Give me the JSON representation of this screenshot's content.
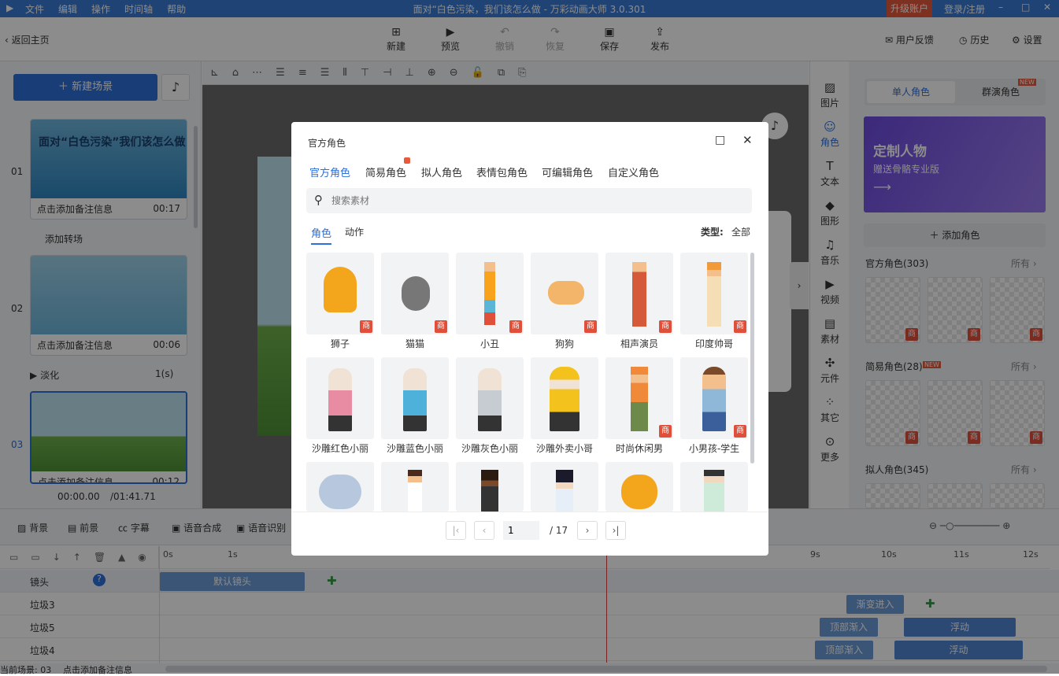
{
  "window": {
    "title": "面对“白色污染，我们该怎么做 - 万彩动画大师 3.0.301",
    "menu": [
      "文件",
      "编辑",
      "操作",
      "时间轴",
      "帮助"
    ],
    "upgrade": "升级账户",
    "login": "登录/注册"
  },
  "toolbar": {
    "back": "返回主页",
    "new": "新建",
    "preview": "预览",
    "undo": "撤销",
    "redo": "恢复",
    "save": "保存",
    "publish": "发布",
    "feedback": "用户反馈",
    "history": "历史",
    "settings": "设置"
  },
  "left": {
    "new_scene": "新建场景",
    "add_transition": "添加转场",
    "scenes": [
      {
        "index": "01",
        "note": "点击添加备注信息",
        "duration": "00:17",
        "title": "面对“白色污染”我们该怎么做"
      },
      {
        "index": "02",
        "note": "点击添加备注信息",
        "duration": "00:06"
      },
      {
        "index": "03",
        "note": "点击添加备注信息",
        "duration": "00:12"
      }
    ],
    "transition_name": "淡化",
    "transition_time": "1(s)",
    "time_current": "00:00.00",
    "time_total": "/01:41.71"
  },
  "right_tabs": [
    "图片",
    "角色",
    "文本",
    "图形",
    "音乐",
    "视频",
    "素材",
    "元件",
    "其它",
    "更多"
  ],
  "right_panel": {
    "tab_single": "单人角色",
    "tab_group": "群演角色",
    "new_badge": "NEW",
    "banner_title": "定制人物",
    "banner_sub": "赠送骨骼专业版",
    "add_role": "添加角色",
    "sec1": "官方角色(303)",
    "sec2": "简易角色(28)",
    "sec3": "拟人角色(345)",
    "all": "所有"
  },
  "dialog": {
    "title": "官方角色",
    "tabs": [
      "官方角色",
      "简易角色",
      "拟人角色",
      "表情包角色",
      "可编辑角色",
      "自定义角色"
    ],
    "search_placeholder": "搜索素材",
    "sub_role": "角色",
    "sub_action": "动作",
    "type_label": "类型:",
    "type_value": "全部",
    "chars_row1": [
      "狮子",
      "猫猫",
      "小丑",
      "狗狗",
      "相声演员",
      "印度帅哥"
    ],
    "chars_row2": [
      "沙雕红色小丽",
      "沙雕蓝色小丽",
      "沙雕灰色小丽",
      "沙雕外卖小哥",
      "时尚休闲男",
      "小男孩-学生"
    ],
    "page": "1",
    "pages": "/ 17",
    "badge": "商"
  },
  "timeline": {
    "tabs": [
      "背景",
      "前景",
      "字幕",
      "语音合成",
      "语音识别"
    ],
    "ticks": [
      "0s",
      "1s",
      "9s",
      "10s",
      "11s",
      "12s"
    ],
    "tracks": [
      "镜头",
      "垃圾3",
      "垃圾5",
      "垃圾4"
    ],
    "clip_camera": "默认镜头",
    "clip_fade": "渐变进入",
    "clip_top": "顶部渐入",
    "clip_float": "浮动",
    "status_scene": "当前场景: 03",
    "status_note": "点击添加备注信息"
  }
}
